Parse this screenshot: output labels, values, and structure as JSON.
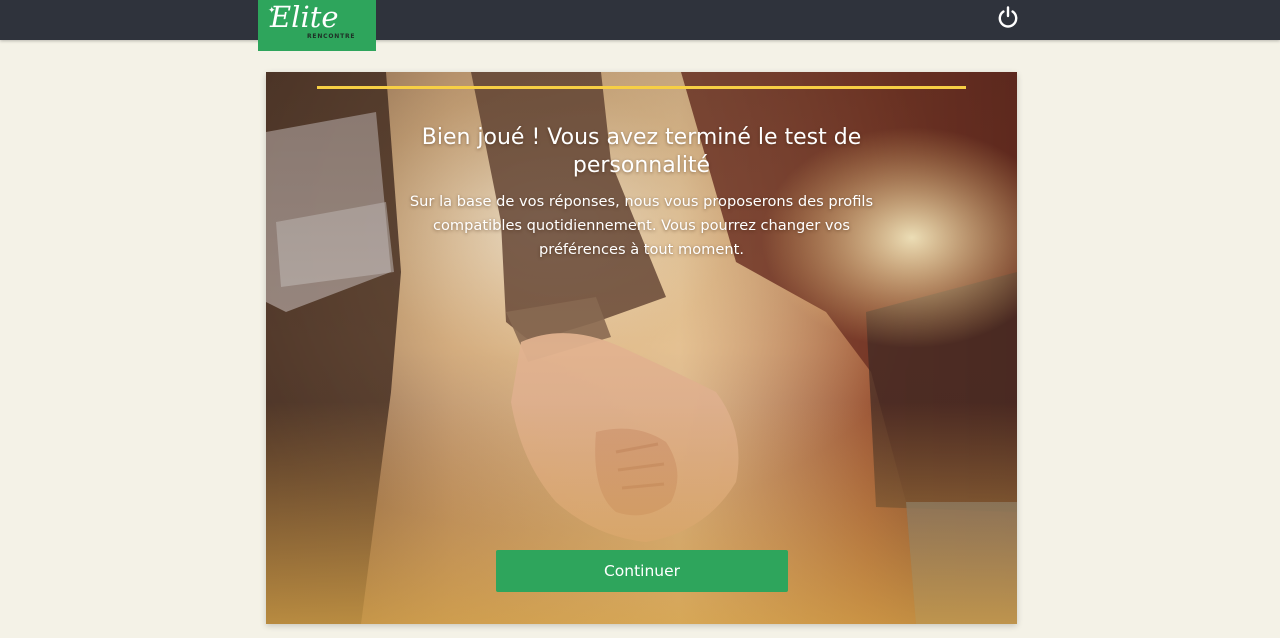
{
  "header": {
    "logo": {
      "script_text": "Elite",
      "sub_text": "RENCONTRE"
    },
    "power_icon": "power-icon"
  },
  "card": {
    "progress_percent": 100,
    "title": "Bien joué ! Vous avez terminé le test de personnalité",
    "subtitle": "Sur la base de vos réponses, nous vous proposerons des profils compatibles quotidiennement. Vous pourrez changer vos préférences à tout moment.",
    "continue_label": "Continuer"
  },
  "colors": {
    "topbar": "#2f333c",
    "brand_green": "#2ea55c",
    "progress_yellow": "#f7cf44",
    "page_background": "#f4f2e7"
  }
}
